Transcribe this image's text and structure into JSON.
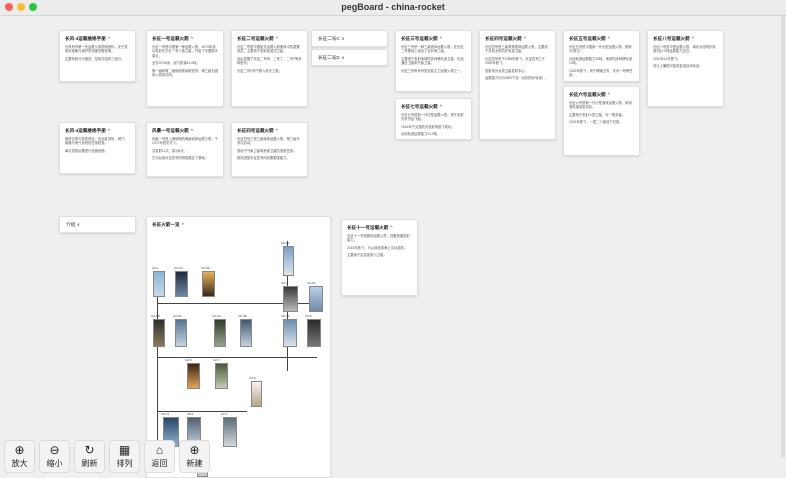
{
  "window": {
    "title": "pegBoard - china-rocket"
  },
  "colors": {
    "close": "#fe5f57",
    "minimize": "#febc2e",
    "zoom": "#28c840"
  },
  "cards": {
    "c1": {
      "title": "长风-4运载维修手册",
      "chev": "^",
      "body": [
        "长风系列第一代运载火箭说明资料，关于发射前准备与维护的详细流程说明。",
        "主要系统分为推进、控制与结构三部分。"
      ]
    },
    "c2": {
      "title": "长征一号运载火箭",
      "chev": "^",
      "body": [
        "长征一号是中国第一种运载火箭，1970年成功发射东方红一号人造卫星，开启了中国航天事业。",
        "全长29.86米，起飞质量81.6吨。",
        "第一级和第二级使用液体推进剂，第三级为固体火箭发动机。"
      ]
    },
    "c3": {
      "title": "长征二号运载火箭",
      "chev": "^",
      "body": [
        "长征二号是中国航天运载火箭家族中的重要成员，主要用于发射返回式卫星。",
        "此后发展了长征二号丙、二号丁、二号F等多种型号。",
        "长征二号F用于载人航天工程。"
      ]
    },
    "c4a": {
      "title": "长征二号C",
      "chev": "v"
    },
    "c4b": {
      "title": "长征二号D",
      "chev": "v"
    },
    "c5": {
      "title": "长征三号运载火箭",
      "chev": "^",
      "body": [
        "长征三号是一种三级液体运载火箭，在长征二号基础上增加了氢氧第三级。",
        "主要用于发射地球同步转移轨道卫星，包括通信卫星和气象卫星。",
        "长征三号甲系列是目前主力运载火箭之一。"
      ]
    },
    "c6": {
      "title": "长征四号运载火箭",
      "chev": "^",
      "body": [
        "长征四号是三级常规液体运载火箭，主要用于发射太阳同步轨道卫星。",
        "长征四号甲于1988年首飞，长征四号乙于1999年首飞。",
        "发射场为太原卫星发射中心。",
        "运载能力约为2800千克（太阳同步轨道）。"
      ]
    },
    "c7": {
      "title": "长征五号运载火箭",
      "chev": "^",
      "body": [
        "长征五号是中国新一代大型运载火箭，被称为“胖五”。",
        "近地轨道运载能力25吨，地球同步转移轨道14吨。",
        "2016年首飞，用于嫦娥五号、天问一号等任务。"
      ]
    },
    "c8": {
      "title": "长征六号运载火箭",
      "chev": "^",
      "body": [
        "长征六号是新一代小型液体运载火箭，采用液氧煤油发动机。",
        "主要用于发射小型卫星，可一箭多星。",
        "2015年首飞，一箭二十星创下纪录。"
      ]
    },
    "c9": {
      "title": "长征八号运载火箭",
      "chev": "^",
      "body": [
        "长征八号是中型运载火箭，填补太阳同步轨道3至4.5吨运载能力空白。",
        "2020年12月首飞。",
        "设计上兼顾可回收复用技术验证。"
      ]
    },
    "c10": {
      "title": "长风-4运载维修手册",
      "chev": "^",
      "body": [
        "维修记录与检查项目，包括发动机、阀门、管路与电气系统的日常检查。",
        "每次发射后需进行全面检修。"
      ]
    },
    "c11": {
      "title": "风暴一号运载火箭",
      "chev": "^",
      "body": [
        "风暴一号是上海研制的两级液体运载火箭，于1972年首次试飞。",
        "共发射11次，成功6次。",
        "它为后续长征四号的研制奠定了基础。"
      ]
    },
    "c12": {
      "title": "长征四号运载火箭",
      "chev": "^",
      "body": [
        "长征四号乙是三级液体运载火箭，第三级可多次启动。",
        "常用于气象卫星和资源卫星的发射任务。",
        "其改进型长征四号丙具备更强能力。"
      ]
    },
    "c13": {
      "title": "长征七号运载火箭",
      "chev": "^",
      "body": [
        "长征七号是新一代中型运载火箭，用于发射天舟货运飞船。",
        "2016年于文昌航天发射场首飞成功。",
        "近地轨道运载能力13.5吨。"
      ]
    },
    "c14": {
      "title": "介绍",
      "chev": "v"
    },
    "c15": {
      "title": "长征火箭一览",
      "chev": "^"
    },
    "c16": {
      "title": "长征十一号运载火箭",
      "chev": "^",
      "body": [
        "长征十一号是固体运载火箭，具备快速发射能力。",
        "2015年首飞，可从陆地或海上平台发射。",
        "主要用于应急发射小卫星。"
      ]
    }
  },
  "diagram": {
    "labels": [
      "CZ-1",
      "CZ-2C",
      "CZ-2D",
      "CZ-2F",
      "CZ-3",
      "CZ-3A",
      "CZ-3B",
      "CZ-3C",
      "CZ-4A",
      "CZ-4B",
      "CZ-4C",
      "CZ-5",
      "CZ-6",
      "CZ-7",
      "CZ-8",
      "CZ-11",
      "FB-1",
      "KZ-1"
    ]
  },
  "toolbar": {
    "zoom_in": {
      "icon": "zoom-in",
      "label": "放大"
    },
    "zoom_out": {
      "icon": "zoom-out",
      "label": "缩小"
    },
    "refresh": {
      "icon": "refresh",
      "label": "刷新"
    },
    "arrange": {
      "icon": "grid",
      "label": "排列"
    },
    "home": {
      "icon": "home",
      "label": "返回"
    },
    "new": {
      "icon": "plus",
      "label": "新建"
    }
  }
}
